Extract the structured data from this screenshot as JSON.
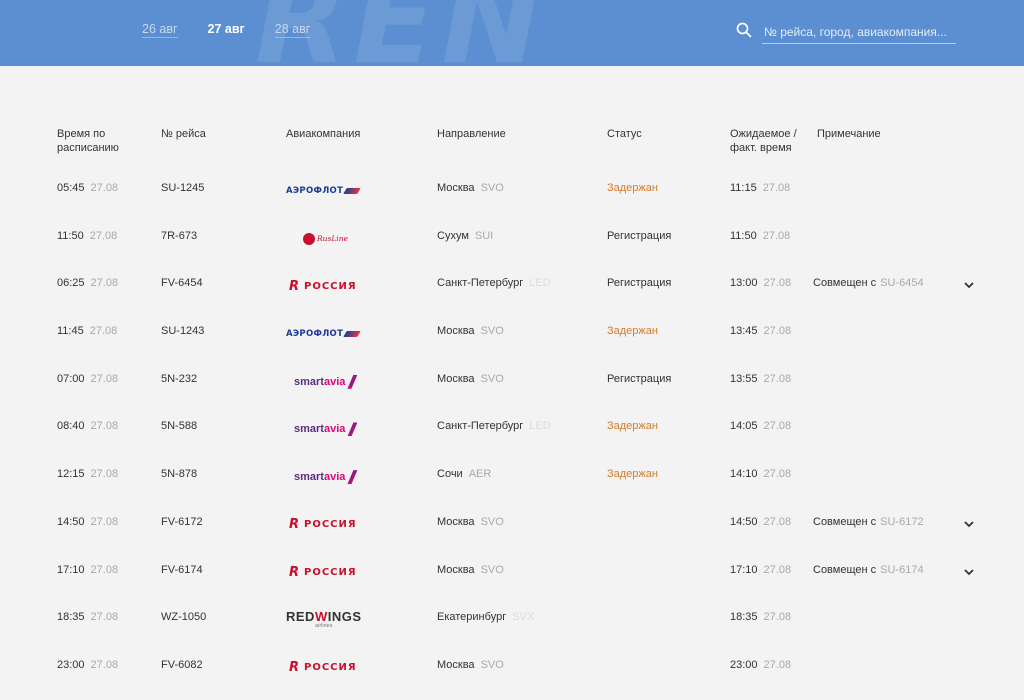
{
  "header": {
    "watermark": "REN",
    "dates": [
      {
        "label": "26 авг",
        "active": false
      },
      {
        "label": "27 авг",
        "active": true
      },
      {
        "label": "28 авг",
        "active": false
      }
    ],
    "search": {
      "placeholder": "№ рейса, город, авиакомпания..."
    }
  },
  "columns": {
    "scheduled": "Время по расписанию",
    "flight": "№ рейса",
    "airline": "Авиакомпания",
    "destination": "Направление",
    "status": "Статус",
    "expected": "Ожидаемое / факт. время",
    "note": "Примечание"
  },
  "colors": {
    "header_bg": "#5b8fd1",
    "delayed": "#d77b29"
  },
  "logos": {
    "aeroflot": "АЭРОФЛОТ",
    "rossiya": "РОССИЯ",
    "smartavia_a": "smart",
    "smartavia_b": "avia",
    "rusline": "RusLine",
    "redwings_a": "RED",
    "redwings_b": "W",
    "redwings_c": "INGS",
    "redwings_sub": "airlines"
  },
  "flights": [
    {
      "time": "05:45",
      "date": "27.08",
      "flight": "SU-1245",
      "airline": "aeroflot",
      "city": "Москва",
      "code": "SVO",
      "status": "Задержан",
      "delayed": true,
      "exp_time": "11:15",
      "exp_date": "27.08",
      "note": "",
      "note_code": ""
    },
    {
      "time": "11:50",
      "date": "27.08",
      "flight": "7R-673",
      "airline": "rusline",
      "city": "Сухум",
      "code": "SUI",
      "status": "Регистрация",
      "delayed": false,
      "exp_time": "11:50",
      "exp_date": "27.08",
      "note": "",
      "note_code": ""
    },
    {
      "time": "06:25",
      "date": "27.08",
      "flight": "FV-6454",
      "airline": "rossiya",
      "city": "Санкт-Петербург",
      "code": "LED",
      "status": "Регистрация",
      "delayed": false,
      "exp_time": "13:00",
      "exp_date": "27.08",
      "note": "Совмещен с",
      "note_code": "SU-6454"
    },
    {
      "time": "11:45",
      "date": "27.08",
      "flight": "SU-1243",
      "airline": "aeroflot",
      "city": "Москва",
      "code": "SVO",
      "status": "Задержан",
      "delayed": true,
      "exp_time": "13:45",
      "exp_date": "27.08",
      "note": "",
      "note_code": ""
    },
    {
      "time": "07:00",
      "date": "27.08",
      "flight": "5N-232",
      "airline": "smartavia",
      "city": "Москва",
      "code": "SVO",
      "status": "Регистрация",
      "delayed": false,
      "exp_time": "13:55",
      "exp_date": "27.08",
      "note": "",
      "note_code": ""
    },
    {
      "time": "08:40",
      "date": "27.08",
      "flight": "5N-588",
      "airline": "smartavia",
      "city": "Санкт-Петербург",
      "code": "LED",
      "status": "Задержан",
      "delayed": true,
      "exp_time": "14:05",
      "exp_date": "27.08",
      "note": "",
      "note_code": ""
    },
    {
      "time": "12:15",
      "date": "27.08",
      "flight": "5N-878",
      "airline": "smartavia",
      "city": "Сочи",
      "code": "AER",
      "status": "Задержан",
      "delayed": true,
      "exp_time": "14:10",
      "exp_date": "27.08",
      "note": "",
      "note_code": ""
    },
    {
      "time": "14:50",
      "date": "27.08",
      "flight": "FV-6172",
      "airline": "rossiya",
      "city": "Москва",
      "code": "SVO",
      "status": "",
      "delayed": false,
      "exp_time": "14:50",
      "exp_date": "27.08",
      "note": "Совмещен с",
      "note_code": "SU-6172"
    },
    {
      "time": "17:10",
      "date": "27.08",
      "flight": "FV-6174",
      "airline": "rossiya",
      "city": "Москва",
      "code": "SVO",
      "status": "",
      "delayed": false,
      "exp_time": "17:10",
      "exp_date": "27.08",
      "note": "Совмещен с",
      "note_code": "SU-6174"
    },
    {
      "time": "18:35",
      "date": "27.08",
      "flight": "WZ-1050",
      "airline": "redwings",
      "city": "Екатеринбург",
      "code": "SVX",
      "status": "",
      "delayed": false,
      "exp_time": "18:35",
      "exp_date": "27.08",
      "note": "",
      "note_code": ""
    },
    {
      "time": "23:00",
      "date": "27.08",
      "flight": "FV-6082",
      "airline": "rossiya",
      "city": "Москва",
      "code": "SVO",
      "status": "",
      "delayed": false,
      "exp_time": "23:00",
      "exp_date": "27.08",
      "note": "",
      "note_code": ""
    }
  ]
}
